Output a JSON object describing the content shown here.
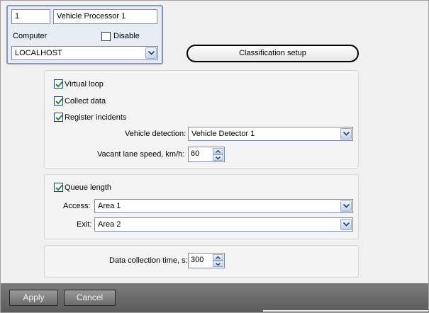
{
  "object": {
    "id": "1",
    "name": "Vehicle Processor 1",
    "computer_label": "Computer",
    "disable_label": "Disable",
    "disable_checked": false,
    "computer_value": "LOCALHOST"
  },
  "classification_button": "Classification setup",
  "options": {
    "virtual_loop_label": "Virtual loop",
    "virtual_loop_checked": true,
    "collect_data_label": "Collect data",
    "collect_data_checked": true,
    "register_incidents_label": "Register incidents",
    "register_incidents_checked": true,
    "vehicle_detection_label": "Vehicle detection:",
    "vehicle_detection_value": "Vehicle Detector 1",
    "vacant_speed_label": "Vacant lane speed, km/h:",
    "vacant_speed_value": "60"
  },
  "queue": {
    "queue_length_label": "Queue length",
    "queue_length_checked": true,
    "access_label": "Access:",
    "access_value": "Area 1",
    "exit_label": "Exit:",
    "exit_value": "Area 2"
  },
  "collection": {
    "time_label": "Data collection time, s:",
    "time_value": "300"
  },
  "buttons": {
    "apply": "Apply",
    "cancel": "Cancel"
  },
  "colors": {
    "panel_border": "#8a97b8",
    "panel_bg": "#e8ecf4",
    "bottom_bar": "#6b6b6b",
    "check_mark": "#2c8a2c"
  }
}
